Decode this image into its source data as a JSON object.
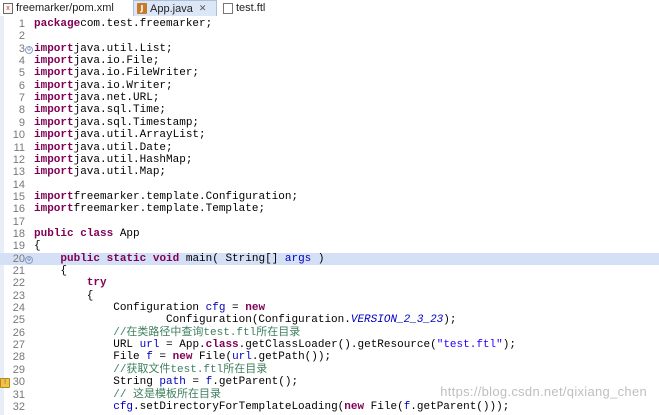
{
  "tabs": [
    {
      "label": "freemarker/pom.xml",
      "icon": "xml-file-icon",
      "active": false
    },
    {
      "label": "App.java",
      "icon": "java-file-icon",
      "active": true
    },
    {
      "label": "test.ftl",
      "icon": "text-file-icon",
      "active": false
    }
  ],
  "close_glyph": "✕",
  "editor": {
    "lines": [
      {
        "n": "1",
        "tokens": [
          [
            "kw",
            "package"
          ],
          [
            "",
            "com.test.freemarker;"
          ]
        ]
      },
      {
        "n": "2",
        "tokens": []
      },
      {
        "n": "3",
        "fold": "⊖",
        "tokens": [
          [
            "kw",
            "import"
          ],
          [
            "",
            "java.util.List;"
          ]
        ]
      },
      {
        "n": "4",
        "tokens": [
          [
            "kw",
            "import"
          ],
          [
            "",
            "java.io.File;"
          ]
        ]
      },
      {
        "n": "5",
        "tokens": [
          [
            "kw",
            "import"
          ],
          [
            "",
            "java.io.FileWriter;"
          ]
        ]
      },
      {
        "n": "6",
        "tokens": [
          [
            "kw",
            "import"
          ],
          [
            "",
            "java.io.Writer;"
          ]
        ]
      },
      {
        "n": "7",
        "tokens": [
          [
            "kw",
            "import"
          ],
          [
            "",
            "java.net.URL;"
          ]
        ]
      },
      {
        "n": "8",
        "tokens": [
          [
            "kw",
            "import"
          ],
          [
            "",
            "java.sql.Time;"
          ]
        ]
      },
      {
        "n": "9",
        "tokens": [
          [
            "kw",
            "import"
          ],
          [
            "",
            "java.sql.Timestamp;"
          ]
        ]
      },
      {
        "n": "10",
        "tokens": [
          [
            "kw",
            "import"
          ],
          [
            "",
            "java.util.ArrayList;"
          ]
        ]
      },
      {
        "n": "11",
        "tokens": [
          [
            "kw",
            "import"
          ],
          [
            "",
            "java.util.Date;"
          ]
        ]
      },
      {
        "n": "12",
        "tokens": [
          [
            "kw",
            "import"
          ],
          [
            "",
            "java.util.HashMap;"
          ]
        ]
      },
      {
        "n": "13",
        "tokens": [
          [
            "kw",
            "import"
          ],
          [
            "",
            "java.util.Map;"
          ]
        ]
      },
      {
        "n": "14",
        "tokens": []
      },
      {
        "n": "15",
        "tokens": [
          [
            "kw",
            "import"
          ],
          [
            "",
            "freemarker.template.Configuration;"
          ]
        ]
      },
      {
        "n": "16",
        "tokens": [
          [
            "kw",
            "import"
          ],
          [
            "",
            "freemarker.template.Template;"
          ]
        ]
      },
      {
        "n": "17",
        "tokens": []
      },
      {
        "n": "18",
        "tokens": [
          [
            "kw",
            "public"
          ],
          [
            "",
            " "
          ],
          [
            "kw",
            "class"
          ],
          [
            "",
            " App"
          ]
        ]
      },
      {
        "n": "19",
        "tokens": [
          [
            "",
            "{"
          ]
        ]
      },
      {
        "n": "20",
        "fold": "⊖",
        "hl": true,
        "tokens": [
          [
            "",
            "    "
          ],
          [
            "kw",
            "public"
          ],
          [
            "",
            " "
          ],
          [
            "kw",
            "static"
          ],
          [
            "",
            " "
          ],
          [
            "kw",
            "void"
          ],
          [
            "",
            " main( String[] "
          ],
          [
            "var",
            "args"
          ],
          [
            "",
            " )"
          ]
        ]
      },
      {
        "n": "21",
        "tokens": [
          [
            "",
            "    {"
          ]
        ]
      },
      {
        "n": "22",
        "tokens": [
          [
            "",
            "        "
          ],
          [
            "kw",
            "try"
          ]
        ]
      },
      {
        "n": "23",
        "tokens": [
          [
            "",
            "        {"
          ]
        ]
      },
      {
        "n": "24",
        "tokens": [
          [
            "",
            "            Configuration "
          ],
          [
            "var",
            "cfg"
          ],
          [
            "",
            " = "
          ],
          [
            "kw",
            "new"
          ]
        ]
      },
      {
        "n": "25",
        "tokens": [
          [
            "",
            "                    Configuration(Configuration."
          ],
          [
            "sfield",
            "VERSION_2_3_23"
          ],
          [
            "",
            ");"
          ]
        ]
      },
      {
        "n": "26",
        "tokens": [
          [
            "",
            "            "
          ],
          [
            "cmt",
            "//在类路径中查询test.ftl所在目录"
          ]
        ]
      },
      {
        "n": "27",
        "tokens": [
          [
            "",
            "            URL "
          ],
          [
            "var",
            "url"
          ],
          [
            "",
            " = App."
          ],
          [
            "kw",
            "class"
          ],
          [
            "",
            ".getClassLoader().getResource("
          ],
          [
            "str",
            "\"test.ftl\""
          ],
          [
            "",
            ");"
          ]
        ]
      },
      {
        "n": "28",
        "tokens": [
          [
            "",
            "            File "
          ],
          [
            "var",
            "f"
          ],
          [
            "",
            " = "
          ],
          [
            "kw",
            "new"
          ],
          [
            "",
            " File("
          ],
          [
            "var",
            "url"
          ],
          [
            "",
            ".getPath());"
          ]
        ]
      },
      {
        "n": "29",
        "tokens": [
          [
            "",
            "            "
          ],
          [
            "cmt",
            "//获取文件test.ftl所在目录"
          ]
        ]
      },
      {
        "n": "30",
        "warn": "!",
        "tokens": [
          [
            "",
            "            String "
          ],
          [
            "var",
            "path"
          ],
          [
            "",
            " = "
          ],
          [
            "var",
            "f"
          ],
          [
            "",
            ".getParent();"
          ]
        ]
      },
      {
        "n": "31",
        "tokens": [
          [
            "",
            "            "
          ],
          [
            "cmt",
            "// 这是模板所在目录"
          ]
        ]
      },
      {
        "n": "32",
        "tokens": [
          [
            "",
            "            "
          ],
          [
            "var",
            "cfg"
          ],
          [
            "",
            ".setDirectoryForTemplateLoading("
          ],
          [
            "kw",
            "new"
          ],
          [
            "",
            " File("
          ],
          [
            "var",
            "f"
          ],
          [
            "",
            ".getParent()));"
          ]
        ]
      }
    ]
  },
  "watermark": "https://blog.csdn.net/qixiang_chen",
  "colors": {
    "keyword": "#7f0055",
    "variable": "#0000c0",
    "string": "#2a00ff",
    "comment": "#3f7f5f",
    "line_number": "#787878",
    "active_tab": "#dbe7f7"
  }
}
